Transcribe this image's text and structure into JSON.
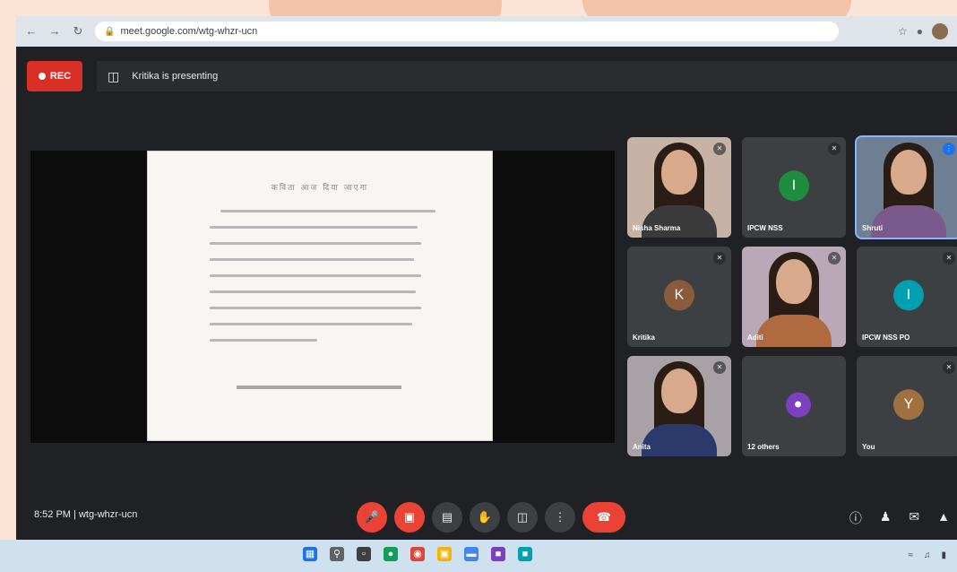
{
  "browser": {
    "url": "meet.google.com/wtg-whzr-ucn"
  },
  "meeting": {
    "rec_label": "REC",
    "presenting_text": "Kritika is presenting",
    "time": "8:52 PM",
    "code": "wtg-whzr-ucn"
  },
  "slide": {
    "title": "कविता आज दिया जाएगा"
  },
  "participants": [
    {
      "name": "Nisha Sharma",
      "type": "video",
      "muted": true
    },
    {
      "name": "IPCW NSS",
      "type": "avatar",
      "avatar_letter": "I",
      "avatar_color": "#1e8e3e",
      "muted": true
    },
    {
      "name": "Shruti",
      "type": "video",
      "muted": false,
      "active": true
    },
    {
      "name": "Kritika",
      "type": "avatar",
      "avatar_letter": "K",
      "avatar_color": "#8a5a3c",
      "muted": true
    },
    {
      "name": "Aditi",
      "type": "video",
      "muted": true
    },
    {
      "name": "IPCW NSS PO",
      "type": "avatar",
      "avatar_letter": "I",
      "avatar_color": "#00a0b0",
      "muted": true
    },
    {
      "name": "Anita",
      "type": "video",
      "muted": true
    },
    {
      "name": "12 others",
      "type": "others",
      "muted": false
    },
    {
      "name": "You",
      "type": "avatar",
      "avatar_letter": "Y",
      "avatar_color": "#a07040",
      "muted": true
    }
  ],
  "controls": {
    "mic_icon": "mic-off-icon",
    "cam_icon": "camera-off-icon",
    "captions_icon": "captions-icon",
    "hand_icon": "raise-hand-icon",
    "present_icon": "present-icon",
    "more_icon": "more-icon",
    "end_icon": "end-call-icon"
  },
  "colors": {
    "meet_bg": "#202124",
    "tile_bg": "#3c4043",
    "danger": "#ea4335",
    "accent": "#8ab4f8"
  }
}
